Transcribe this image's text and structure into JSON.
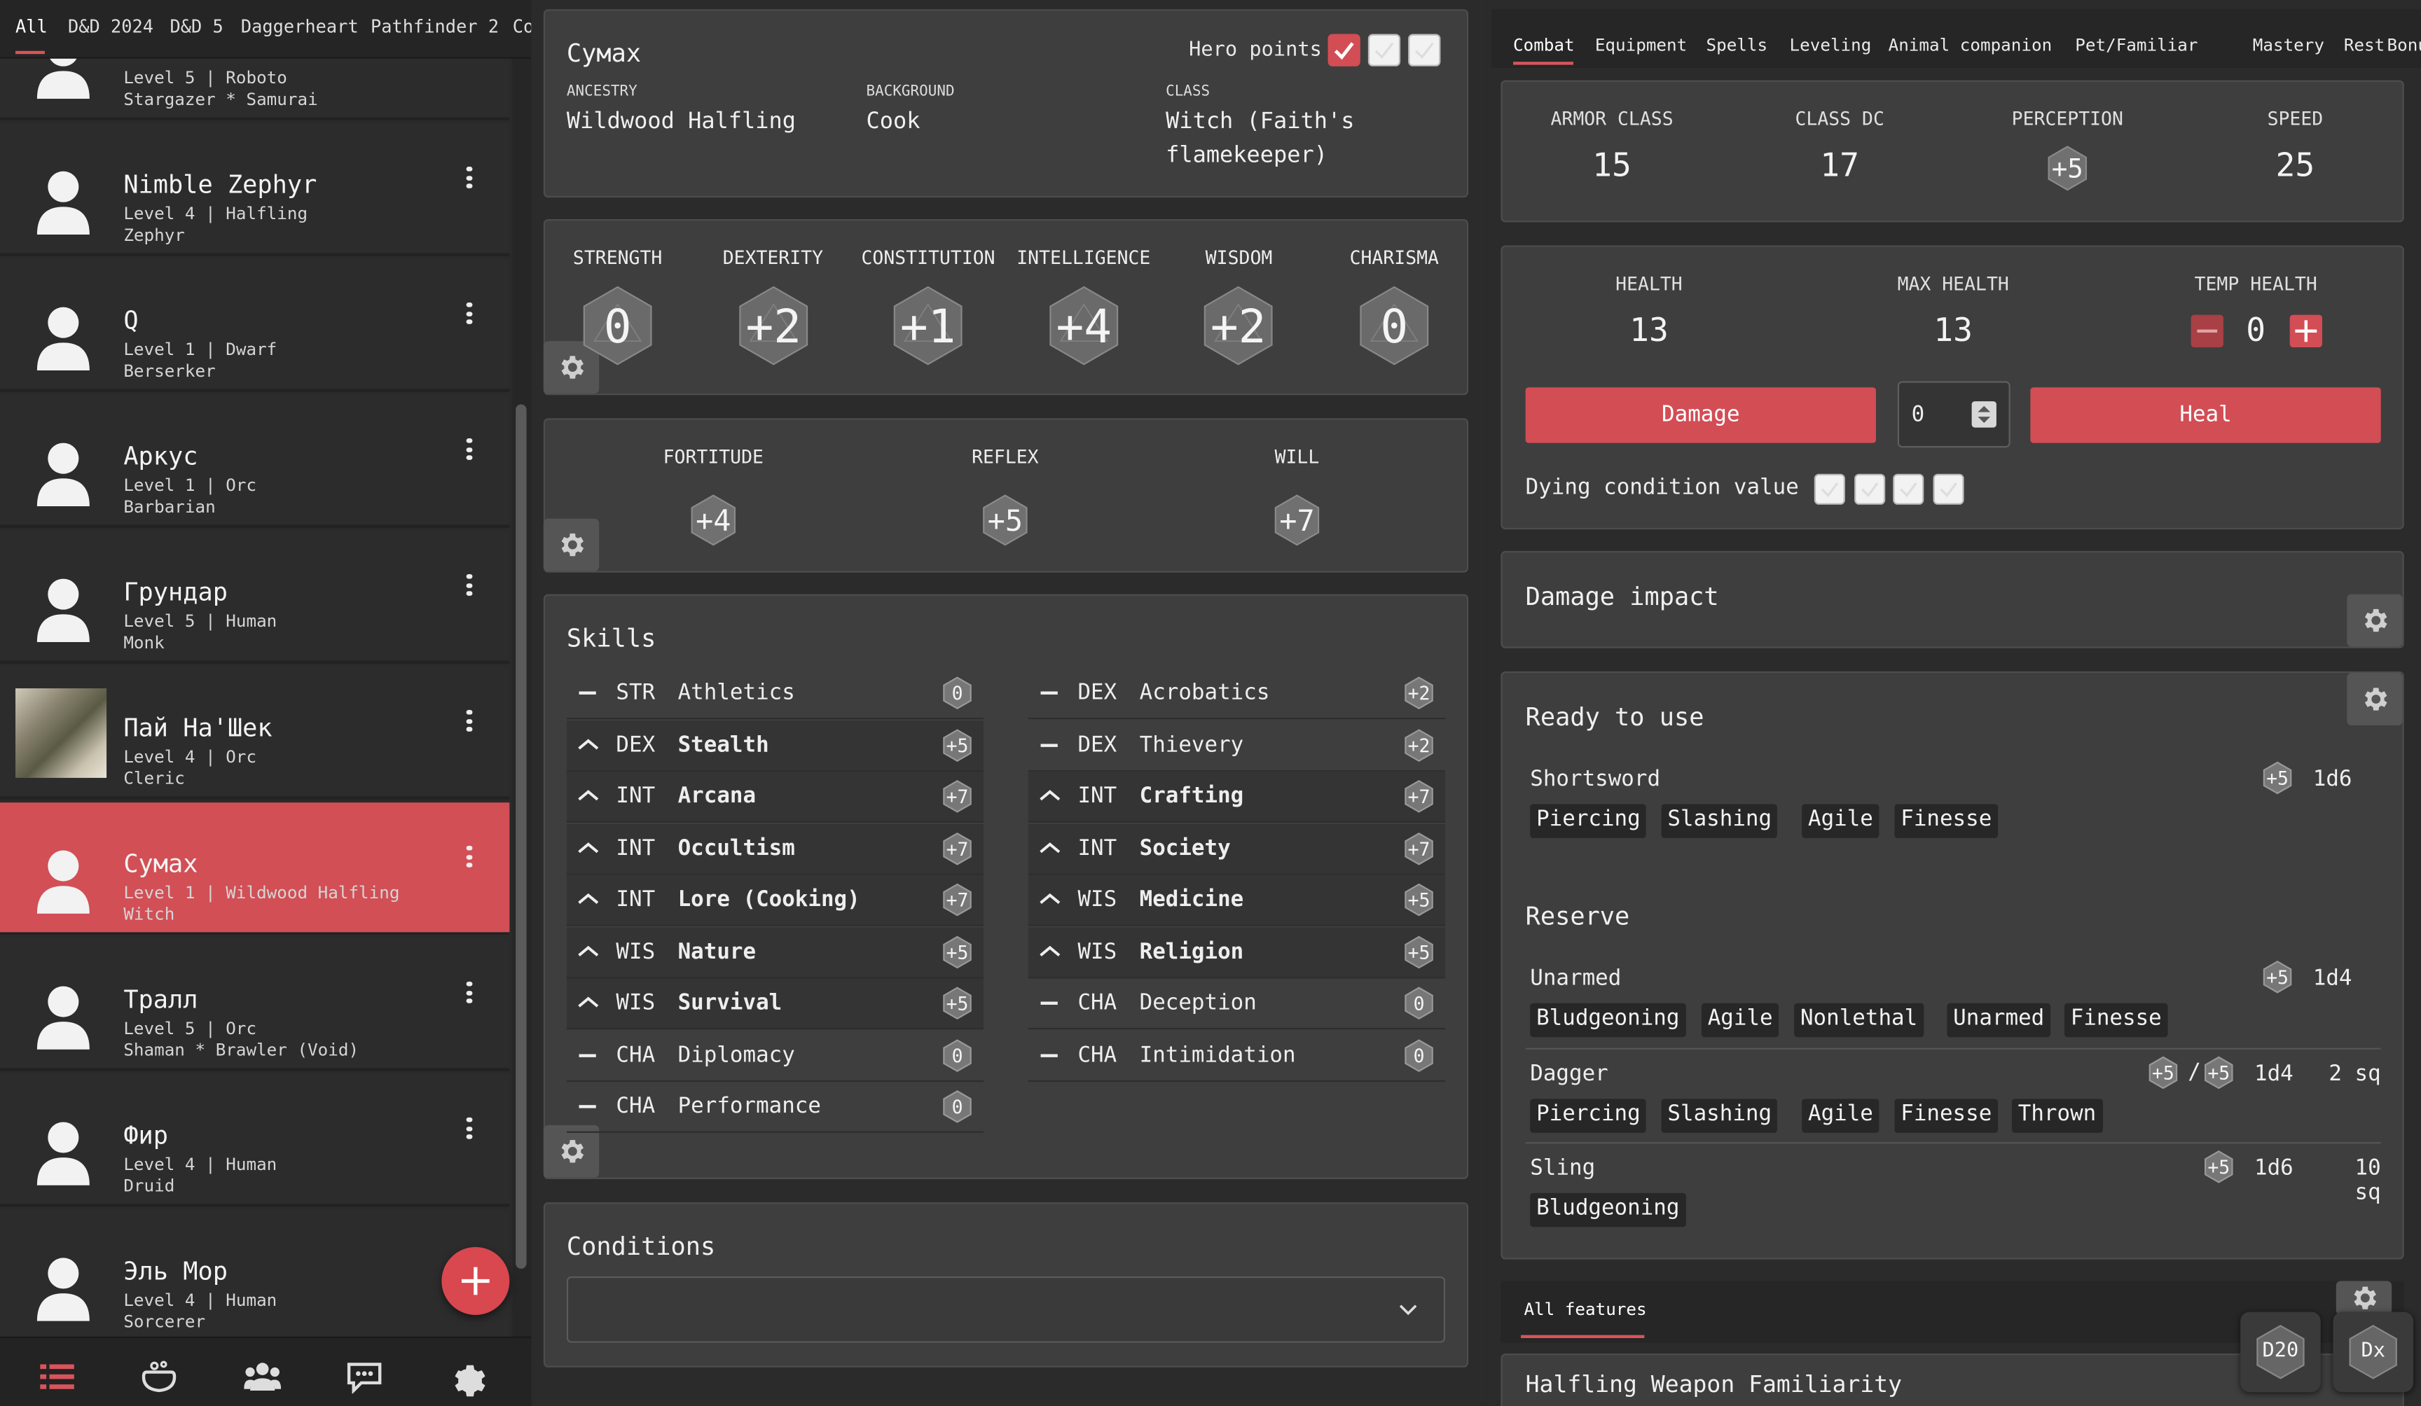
{
  "topnav": [
    "All",
    "D&D 2024",
    "D&D 5",
    "Daggerheart",
    "Pathfinder 2",
    "Co"
  ],
  "characters": [
    {
      "name": "",
      "sub1": "Level 5 | Roboto",
      "sub2": "Stargazer * Samurai",
      "photo": false,
      "active": false
    },
    {
      "name": "Nimble Zephyr",
      "sub1": "Level 4 | Halfling",
      "sub2": "Zephyr",
      "photo": false,
      "active": false
    },
    {
      "name": "Q",
      "sub1": "Level 1 | Dwarf",
      "sub2": "Berserker",
      "photo": false,
      "active": false
    },
    {
      "name": "Аркус",
      "sub1": "Level 1 | Orc",
      "sub2": "Barbarian",
      "photo": false,
      "active": false
    },
    {
      "name": "Грундар",
      "sub1": "Level 5 | Human",
      "sub2": "Monk",
      "photo": false,
      "active": false
    },
    {
      "name": "Пай На'Шек",
      "sub1": "Level 4 | Orc",
      "sub2": "Cleric",
      "photo": true,
      "active": false
    },
    {
      "name": "Сумах",
      "sub1": "Level 1 | Wildwood Halfling",
      "sub2": "Witch",
      "photo": false,
      "active": true
    },
    {
      "name": "Тралл",
      "sub1": "Level 5 | Orc",
      "sub2": "Shaman * Brawler (Void)",
      "photo": false,
      "active": false
    },
    {
      "name": "Фир",
      "sub1": "Level 4 | Human",
      "sub2": "Druid",
      "photo": false,
      "active": false
    },
    {
      "name": "Эль Мор",
      "sub1": "Level 4 | Human",
      "sub2": "Sorcerer",
      "photo": false,
      "active": false
    }
  ],
  "header": {
    "name": "Сумах",
    "hero_points_label": "Hero points",
    "hero_points": [
      true,
      false,
      false
    ],
    "ancestry_label": "ANCESTRY",
    "ancestry": "Wildwood Halfling",
    "background_label": "BACKGROUND",
    "background": "Cook",
    "class_label": "CLASS",
    "class_line1": "Witch (Faith's",
    "class_line2": "flamekeeper)"
  },
  "abilities": [
    {
      "name": "STRENGTH",
      "mod": "0"
    },
    {
      "name": "DEXTERITY",
      "mod": "+2"
    },
    {
      "name": "CONSTITUTION",
      "mod": "+1"
    },
    {
      "name": "INTELLIGENCE",
      "mod": "+4"
    },
    {
      "name": "WISDOM",
      "mod": "+2"
    },
    {
      "name": "CHARISMA",
      "mod": "0"
    }
  ],
  "saves": [
    {
      "name": "FORTITUDE",
      "mod": "+4"
    },
    {
      "name": "REFLEX",
      "mod": "+5"
    },
    {
      "name": "WILL",
      "mod": "+7"
    }
  ],
  "skills_title": "Skills",
  "skills_left": [
    {
      "prof": false,
      "ab": "STR",
      "name": "Athletics",
      "mod": "0"
    },
    {
      "prof": true,
      "ab": "DEX",
      "name": "Stealth",
      "mod": "+5"
    },
    {
      "prof": true,
      "ab": "INT",
      "name": "Arcana",
      "mod": "+7"
    },
    {
      "prof": true,
      "ab": "INT",
      "name": "Occultism",
      "mod": "+7"
    },
    {
      "prof": true,
      "ab": "INT",
      "name": "Lore (Cooking)",
      "mod": "+7"
    },
    {
      "prof": true,
      "ab": "WIS",
      "name": "Nature",
      "mod": "+5"
    },
    {
      "prof": true,
      "ab": "WIS",
      "name": "Survival",
      "mod": "+5"
    },
    {
      "prof": false,
      "ab": "CHA",
      "name": "Diplomacy",
      "mod": "0"
    },
    {
      "prof": false,
      "ab": "CHA",
      "name": "Performance",
      "mod": "0"
    }
  ],
  "skills_right": [
    {
      "prof": false,
      "ab": "DEX",
      "name": "Acrobatics",
      "mod": "+2"
    },
    {
      "prof": false,
      "ab": "DEX",
      "name": "Thievery",
      "mod": "+2"
    },
    {
      "prof": true,
      "ab": "INT",
      "name": "Crafting",
      "mod": "+7"
    },
    {
      "prof": true,
      "ab": "INT",
      "name": "Society",
      "mod": "+7"
    },
    {
      "prof": true,
      "ab": "WIS",
      "name": "Medicine",
      "mod": "+5"
    },
    {
      "prof": true,
      "ab": "WIS",
      "name": "Religion",
      "mod": "+5"
    },
    {
      "prof": false,
      "ab": "CHA",
      "name": "Deception",
      "mod": "0"
    },
    {
      "prof": false,
      "ab": "CHA",
      "name": "Intimidation",
      "mod": "0"
    }
  ],
  "conditions_title": "Conditions",
  "tabs": [
    "Combat",
    "Equipment",
    "Spells",
    "Leveling",
    "Animal companion",
    "Pet/Familiar",
    "Mastery",
    "Rest",
    "Bonuse"
  ],
  "combat_stats": [
    {
      "label": "ARMOR CLASS",
      "value": "15"
    },
    {
      "label": "CLASS DC",
      "value": "17"
    },
    {
      "label": "PERCEPTION",
      "value": "+5"
    },
    {
      "label": "SPEED",
      "value": "25"
    }
  ],
  "health": {
    "health_label": "HEALTH",
    "health": "13",
    "max_label": "MAX HEALTH",
    "max": "13",
    "temp_label": "TEMP HEALTH",
    "temp": "0",
    "damage_label": "Damage",
    "heal_label": "Heal",
    "amount": "0",
    "dying_label": "Dying condition value"
  },
  "damage_impact_title": "Damage impact",
  "ready_title": "Ready to use",
  "reserve_title": "Reserve",
  "weapons_ready": [
    {
      "name": "Shortsword",
      "bonus": "+5",
      "damage": "1d6",
      "range": "",
      "traits": [
        "Piercing",
        "Slashing",
        "Agile",
        "Finesse"
      ]
    }
  ],
  "weapons_reserve": [
    {
      "name": "Unarmed",
      "bonus": "+5",
      "damage": "1d4",
      "range": "",
      "traits": [
        "Bludgeoning",
        "Agile",
        "Nonlethal",
        "Unarmed",
        "Finesse"
      ]
    },
    {
      "name": "Dagger",
      "bonus": "+5",
      "bonus2": "+5",
      "damage": "1d4",
      "range": "2 sq",
      "traits": [
        "Piercing",
        "Slashing",
        "Agile",
        "Finesse",
        "Thrown"
      ]
    },
    {
      "name": "Sling",
      "bonus": "+5",
      "damage": "1d6",
      "range": "10 sq",
      "traits": [
        "Bludgeoning"
      ]
    }
  ],
  "features_tab": "All features",
  "feature_first": "Halfling Weapon Familiarity",
  "dice": [
    "D20",
    "Dx"
  ],
  "colors": {
    "accent": "#d24f56",
    "panel": "#3e3e3e",
    "bg": "#2b2b2b"
  }
}
